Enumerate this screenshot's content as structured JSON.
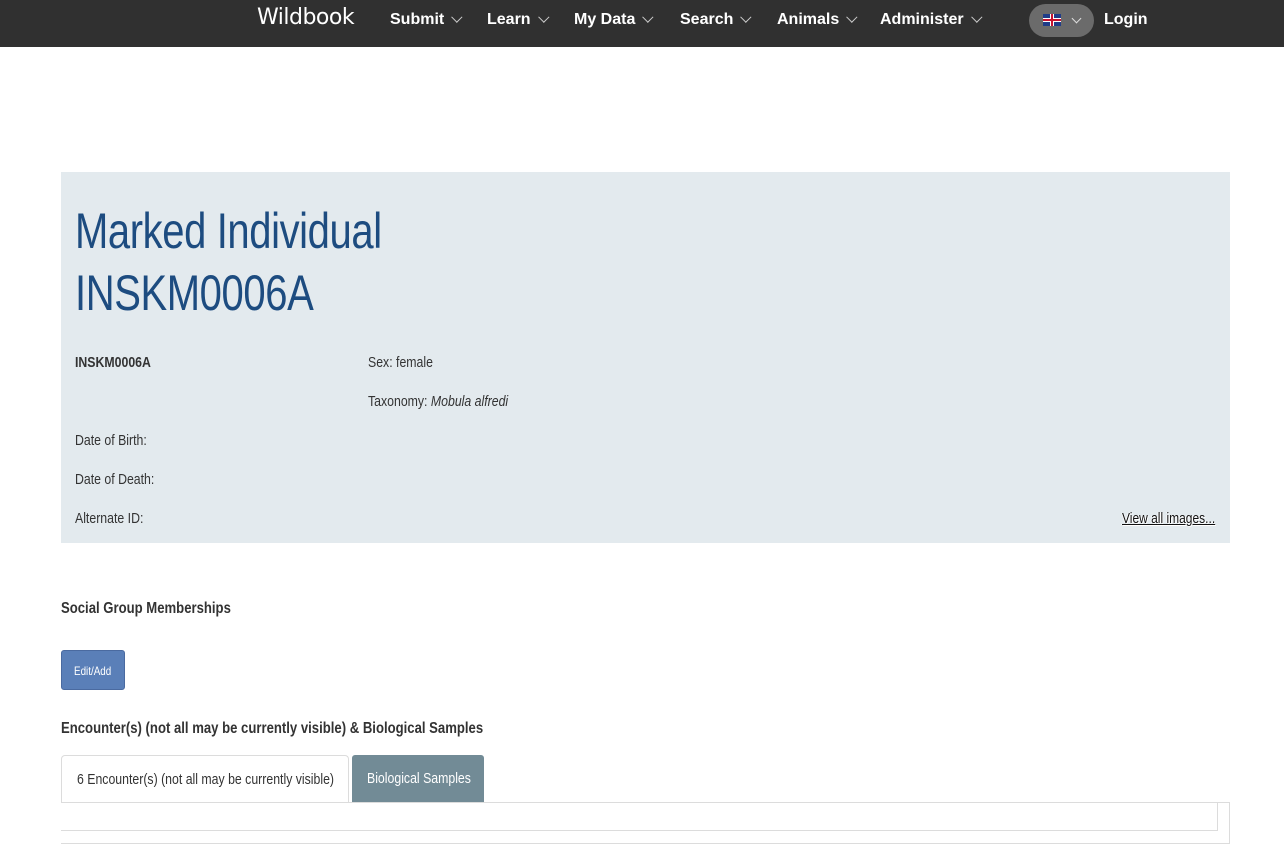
{
  "nav": {
    "brand": "Wildbook",
    "items": [
      "Submit",
      "Learn",
      "My Data",
      "Search",
      "Animals",
      "Administer"
    ],
    "login": "Login",
    "language_icon": "uk-flag-icon"
  },
  "individual": {
    "title_line1": "Marked Individual",
    "title_line2": "INSKM0006A",
    "id": "INSKM0006A",
    "sex_label": "Sex:",
    "sex_value": "female",
    "taxonomy_label": "Taxonomy:",
    "taxonomy_value": "Mobula alfredi",
    "dob_label": "Date of Birth:",
    "dod_label": "Date of Death:",
    "alt_id_label": "Alternate ID:",
    "view_all_images": "View all images..."
  },
  "social": {
    "heading": "Social Group Memberships",
    "edit_button": "Edit/Add"
  },
  "encounters": {
    "heading": "Encounter(s) (not all may be currently visible) & Biological Samples",
    "tabs": [
      "6 Encounter(s) (not all may be currently visible)",
      "Biological Samples"
    ]
  },
  "colors": {
    "navbar": "#303030",
    "panel": "#e3eaee",
    "title": "#1d4c80",
    "edit_button": "#5a7fb8",
    "inactive_tab": "#728b96"
  }
}
